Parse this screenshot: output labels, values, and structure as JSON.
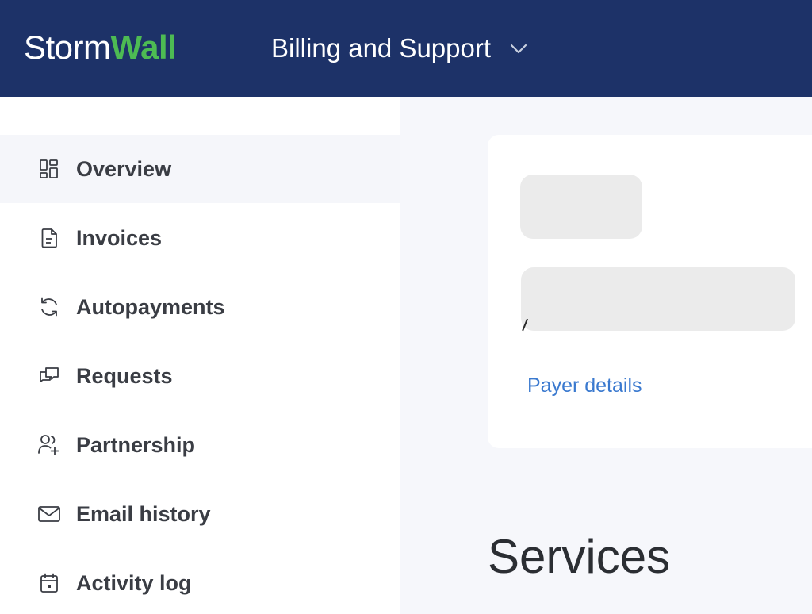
{
  "header": {
    "logo_part1": "Storm",
    "logo_part2": "Wall",
    "section_title": "Billing and Support",
    "section_chevron_icon": "chevron-down-icon",
    "background_color": "#1d3268",
    "logo_accent_color": "#4dbb53"
  },
  "sidebar": {
    "items": [
      {
        "label": "Overview",
        "icon": "grid-icon",
        "active": true
      },
      {
        "label": "Invoices",
        "icon": "document-icon",
        "active": false
      },
      {
        "label": "Autopayments",
        "icon": "refresh-icon",
        "active": false
      },
      {
        "label": "Requests",
        "icon": "chat-icon",
        "active": false
      },
      {
        "label": "Partnership",
        "icon": "user-plus-icon",
        "active": false
      },
      {
        "label": "Email history",
        "icon": "mail-icon",
        "active": false
      },
      {
        "label": "Activity log",
        "icon": "calendar-icon",
        "active": false
      }
    ]
  },
  "main": {
    "card": {
      "payer_link": "Payer details",
      "link_color": "#3a79cf"
    },
    "services_title": "Services"
  }
}
